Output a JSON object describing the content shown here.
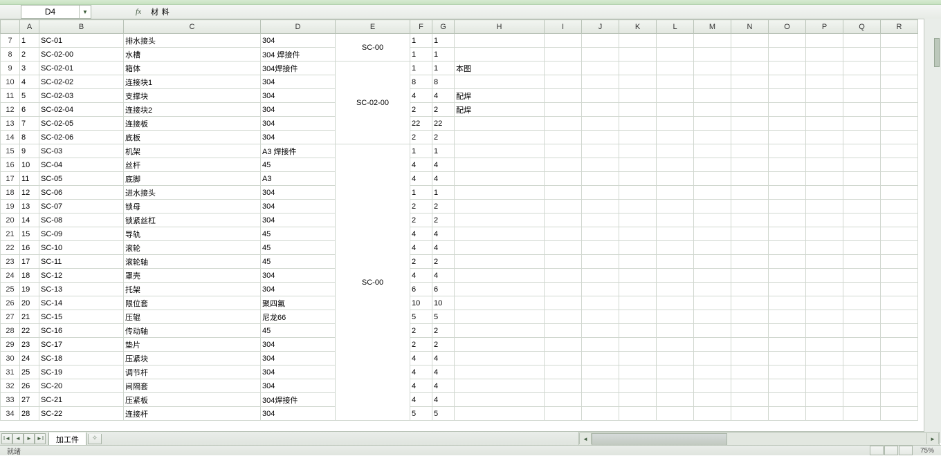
{
  "active_cell_ref": "D4",
  "formula_bar_value": "材 料",
  "columns": [
    "A",
    "B",
    "C",
    "D",
    "E",
    "F",
    "G",
    "H",
    "I",
    "J",
    "K",
    "L",
    "M",
    "N",
    "O",
    "P",
    "Q",
    "R"
  ],
  "first_visible_row": 7,
  "last_visible_row": 34,
  "selected_column": "D",
  "sheet_tab": "加工件",
  "status_text": "就绪",
  "zoom_label": "75%",
  "merges": [
    {
      "col": "E",
      "row_start": 7,
      "row_end": 8,
      "value": "SC-00"
    },
    {
      "col": "E",
      "row_start": 9,
      "row_end": 14,
      "value": "SC-02-00"
    },
    {
      "col": "E",
      "row_start": 15,
      "row_end": 34,
      "value": "SC-00"
    }
  ],
  "rows": [
    {
      "n": 7,
      "A": "1",
      "B": "SC-01",
      "C": "排水接头",
      "D": "304",
      "F": "1",
      "G": "1",
      "H": ""
    },
    {
      "n": 8,
      "A": "2",
      "B": "SC-02-00",
      "C": "水槽",
      "D": "304 焊接件",
      "F": "1",
      "G": "1",
      "H": ""
    },
    {
      "n": 9,
      "A": "3",
      "B": "SC-02-01",
      "C": "箱体",
      "D": "304焊接件",
      "F": "1",
      "G": "1",
      "H": "本图"
    },
    {
      "n": 10,
      "A": "4",
      "B": "SC-02-02",
      "C": "连接块1",
      "D": "304",
      "F": "8",
      "G": "8",
      "H": ""
    },
    {
      "n": 11,
      "A": "5",
      "B": "SC-02-03",
      "C": "支撑块",
      "D": "304",
      "F": "4",
      "G": "4",
      "H": "配焊"
    },
    {
      "n": 12,
      "A": "6",
      "B": "SC-02-04",
      "C": "连接块2",
      "D": "304",
      "F": "2",
      "G": "2",
      "H": "配焊"
    },
    {
      "n": 13,
      "A": "7",
      "B": "SC-02-05",
      "C": "连接板",
      "D": "304",
      "F": "22",
      "G": "22",
      "H": ""
    },
    {
      "n": 14,
      "A": "8",
      "B": "SC-02-06",
      "C": "底板",
      "D": "304",
      "F": "2",
      "G": "2",
      "H": ""
    },
    {
      "n": 15,
      "A": "9",
      "B": "SC-03",
      "C": "机架",
      "D": "A3 焊接件",
      "F": "1",
      "G": "1",
      "H": ""
    },
    {
      "n": 16,
      "A": "10",
      "B": "SC-04",
      "C": "丝杆",
      "D": "45",
      "F": "4",
      "G": "4",
      "H": ""
    },
    {
      "n": 17,
      "A": "11",
      "B": "SC-05",
      "C": "底脚",
      "D": "A3",
      "F": "4",
      "G": "4",
      "H": ""
    },
    {
      "n": 18,
      "A": "12",
      "B": "SC-06",
      "C": "进水接头",
      "D": "304",
      "F": "1",
      "G": "1",
      "H": ""
    },
    {
      "n": 19,
      "A": "13",
      "B": "SC-07",
      "C": "锁母",
      "D": "304",
      "F": "2",
      "G": "2",
      "H": ""
    },
    {
      "n": 20,
      "A": "14",
      "B": "SC-08",
      "C": "锁紧丝杠",
      "D": "304",
      "F": "2",
      "G": "2",
      "H": ""
    },
    {
      "n": 21,
      "A": "15",
      "B": "SC-09",
      "C": "导轨",
      "D": "45",
      "F": "4",
      "G": "4",
      "H": ""
    },
    {
      "n": 22,
      "A": "16",
      "B": "SC-10",
      "C": "滚轮",
      "D": "45",
      "F": "4",
      "G": "4",
      "H": ""
    },
    {
      "n": 23,
      "A": "17",
      "B": "SC-11",
      "C": "滚轮轴",
      "D": "45",
      "F": "2",
      "G": "2",
      "H": ""
    },
    {
      "n": 24,
      "A": "18",
      "B": "SC-12",
      "C": "罩壳",
      "D": "304",
      "F": "4",
      "G": "4",
      "H": ""
    },
    {
      "n": 25,
      "A": "19",
      "B": "SC-13",
      "C": "托架",
      "D": "304",
      "F": "6",
      "G": "6",
      "H": ""
    },
    {
      "n": 26,
      "A": "20",
      "B": "SC-14",
      "C": "限位套",
      "D": "聚四氟",
      "F": "10",
      "G": "10",
      "H": ""
    },
    {
      "n": 27,
      "A": "21",
      "B": "SC-15",
      "C": "压辊",
      "D": "尼龙66",
      "F": "5",
      "G": "5",
      "H": ""
    },
    {
      "n": 28,
      "A": "22",
      "B": "SC-16",
      "C": "传动轴",
      "D": "45",
      "F": "2",
      "G": "2",
      "H": ""
    },
    {
      "n": 29,
      "A": "23",
      "B": "SC-17",
      "C": "垫片",
      "D": "304",
      "F": "2",
      "G": "2",
      "H": ""
    },
    {
      "n": 30,
      "A": "24",
      "B": "SC-18",
      "C": "压紧块",
      "D": "304",
      "F": "4",
      "G": "4",
      "H": ""
    },
    {
      "n": 31,
      "A": "25",
      "B": "SC-19",
      "C": "调节杆",
      "D": "304",
      "F": "4",
      "G": "4",
      "H": ""
    },
    {
      "n": 32,
      "A": "26",
      "B": "SC-20",
      "C": "间隔套",
      "D": "304",
      "F": "4",
      "G": "4",
      "H": ""
    },
    {
      "n": 33,
      "A": "27",
      "B": "SC-21",
      "C": "压紧板",
      "D": "304焊接件",
      "F": "4",
      "G": "4",
      "H": ""
    },
    {
      "n": 34,
      "A": "28",
      "B": "SC-22",
      "C": "连接杆",
      "D": "304",
      "F": "5",
      "G": "5",
      "H": ""
    }
  ]
}
